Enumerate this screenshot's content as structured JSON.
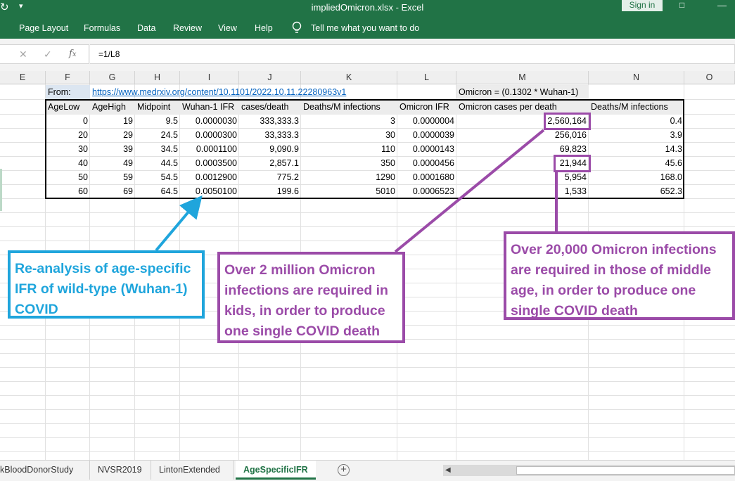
{
  "window": {
    "title": "impliedOmicron.xlsx  -  Excel",
    "signin": "Sign in"
  },
  "ribbon": {
    "tabs": [
      "Page Layout",
      "Formulas",
      "Data",
      "Review",
      "View",
      "Help"
    ],
    "tell_me": "Tell me what you want to do"
  },
  "formula_bar": {
    "formula": "=1/L8"
  },
  "columns": [
    "E",
    "F",
    "G",
    "H",
    "I",
    "J",
    "K",
    "L",
    "M",
    "N",
    "O"
  ],
  "sheet": {
    "from_label": "From:",
    "source_url": "https://www.medrxiv.org/content/10.1101/2022.10.11.22280963v1",
    "omicron_formula_note": "Omicron = (0.1302 * Wuhan-1)",
    "headers": [
      "AgeLow",
      "AgeHigh",
      "Midpoint",
      "Wuhan-1 IFR",
      "cases/death",
      "Deaths/M infections",
      "Omicron IFR",
      "Omicron cases per death",
      "Deaths/M infections"
    ],
    "rows": [
      [
        "0",
        "19",
        "9.5",
        "0.0000030",
        "333,333.3",
        "3",
        "0.0000004",
        "2,560,164",
        "0.4"
      ],
      [
        "20",
        "29",
        "24.5",
        "0.0000300",
        "33,333.3",
        "30",
        "0.0000039",
        "256,016",
        "3.9"
      ],
      [
        "30",
        "39",
        "34.5",
        "0.0001100",
        "9,090.9",
        "110",
        "0.0000143",
        "69,823",
        "14.3"
      ],
      [
        "40",
        "49",
        "44.5",
        "0.0003500",
        "2,857.1",
        "350",
        "0.0000456",
        "21,944",
        "45.6"
      ],
      [
        "50",
        "59",
        "54.5",
        "0.0012900",
        "775.2",
        "1290",
        "0.0001680",
        "5,954",
        "168.0"
      ],
      [
        "60",
        "69",
        "64.5",
        "0.0050100",
        "199.6",
        "5010",
        "0.0006523",
        "1,533",
        "652.3"
      ]
    ]
  },
  "annotations": {
    "blue_callout": [
      "Re-analysis of age-specific",
      "IFR of wild-type (Wuhan-1)",
      "COVID"
    ],
    "kids_callout": [
      "Over 2 million Omicron",
      "infections are required in",
      "kids, in order to produce",
      "one single COVID death"
    ],
    "middle_callout": [
      "Over 20,000 Omicron infections",
      "are required in those of middle",
      "age, in order to produce one",
      "single COVID death"
    ]
  },
  "sheet_tabs": {
    "tabs": [
      "kBloodDonorStudy",
      "NVSR2019",
      "LintonExtended",
      "AgeSpecificIFR"
    ],
    "active": "AgeSpecificIFR"
  },
  "colors": {
    "excel_green": "#217346",
    "callout_blue": "#1fa5dc",
    "callout_purple": "#9b4ba8"
  }
}
